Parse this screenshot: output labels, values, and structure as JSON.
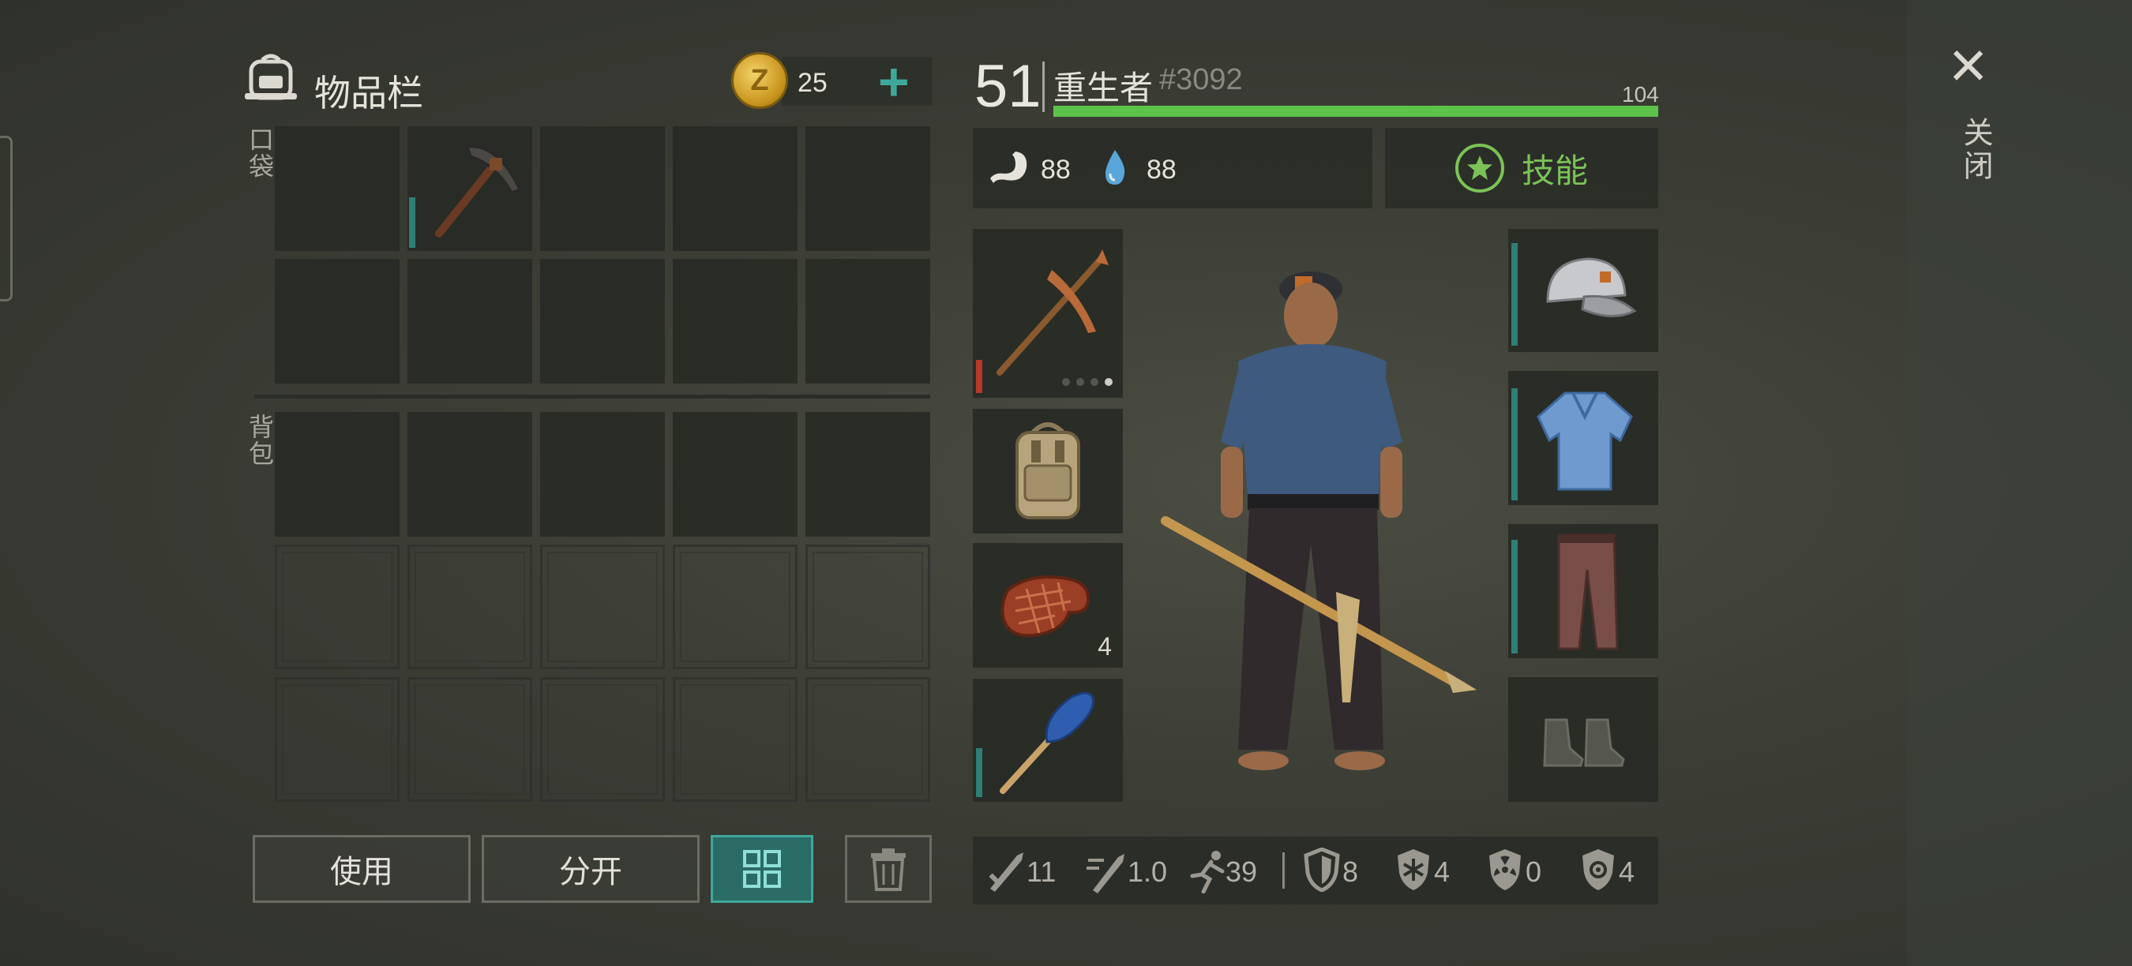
{
  "inventory": {
    "title": "物品栏",
    "coins": "25",
    "add_symbol": "+",
    "coin_glyph": "Z",
    "pocket_label": "口袋",
    "backpack_label": "背包"
  },
  "actions": {
    "use": "使用",
    "split": "分开"
  },
  "character": {
    "level": "51",
    "name": "重生者",
    "id": "#3092",
    "xp_max_label": "104",
    "xp_fraction": 1.0,
    "food": "88",
    "water": "88",
    "skills_label": "技能"
  },
  "equipment": {
    "food_count": "4"
  },
  "attributes": {
    "damage": "11",
    "attack_speed": "1.0",
    "move_speed": "39",
    "armor": "8",
    "cold": "4",
    "radiation": "0",
    "toxic": "4"
  },
  "close": {
    "icon": "×",
    "label": "关闭"
  },
  "colors": {
    "xp": "#5dc249",
    "accent_teal": "#3fa89a",
    "skill_green": "#7bc356",
    "durability_red": "#b8362b",
    "durability_teal": "#2f7f77"
  }
}
